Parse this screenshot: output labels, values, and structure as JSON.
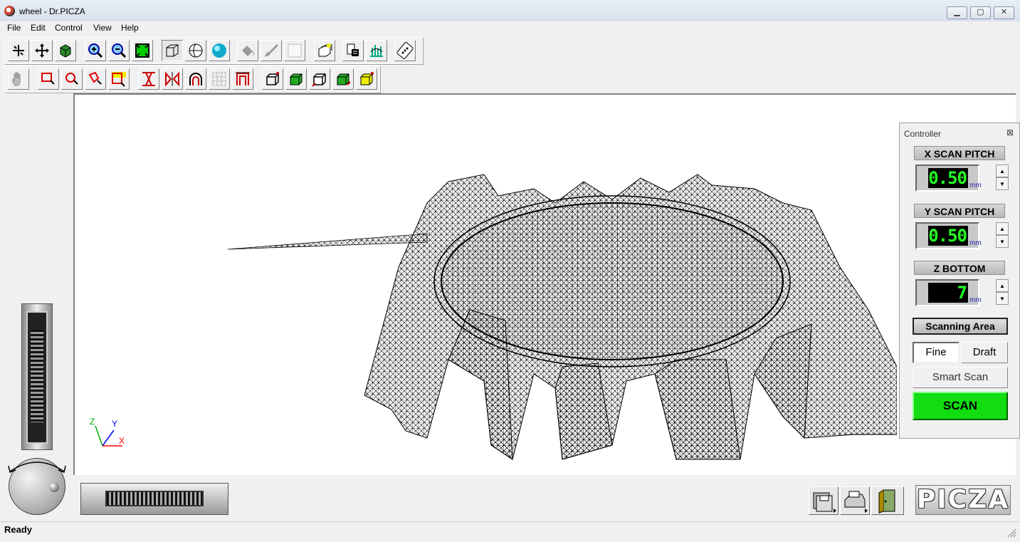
{
  "window": {
    "title": "wheel - Dr.PICZA",
    "min": "▁",
    "max": "▢",
    "close": "✕"
  },
  "menu": [
    "File",
    "Edit",
    "Control",
    "View",
    "Help"
  ],
  "axes": {
    "z": "Z",
    "y": "Y",
    "x": "X"
  },
  "controller": {
    "title": "Controller",
    "close": "⊠",
    "x_pitch": {
      "label": "X SCAN PITCH",
      "value": "0.50",
      "unit": "mm"
    },
    "y_pitch": {
      "label": "Y SCAN PITCH",
      "value": "0.50",
      "unit": "mm"
    },
    "z_bottom": {
      "label": "Z BOTTOM",
      "value": "7",
      "unit": "mm"
    },
    "scanning_area": "Scanning Area",
    "fine": "Fine",
    "draft": "Draft",
    "smart_scan": "Smart Scan",
    "scan": "SCAN"
  },
  "logo": "PICZA",
  "status": "Ready",
  "colors": {
    "scan_button": "#11dd11",
    "lcd_text": "#22ff22",
    "axis_x": "#ff0000",
    "axis_y": "#0000ff",
    "axis_z": "#00aa00"
  }
}
